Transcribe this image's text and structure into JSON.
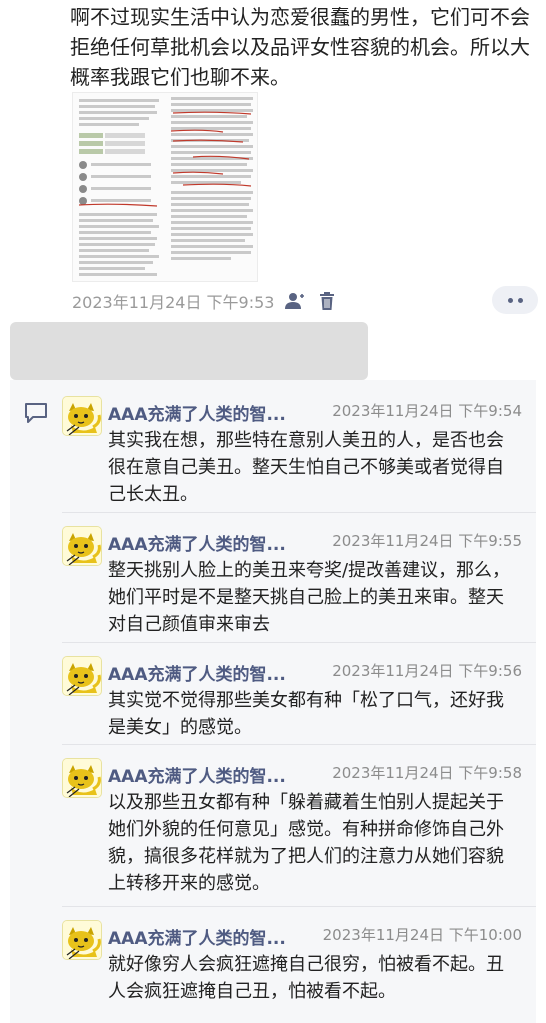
{
  "post": {
    "text": "啊不过现实生活中认为恋爱很蠢的男性，它们可不会拒绝任何草批机会以及品评女性容貌的机会。所以大概率我跟它们也聊不来。",
    "timestamp": "2023年11月24日 下午9:53",
    "icons": [
      "user-icon",
      "trash-icon",
      "more-icon"
    ]
  },
  "comments": [
    {
      "author": "AAA充满了人类的智...",
      "time": "2023年11月24日 下午9:54",
      "text": "其实我在想，那些特在意别人美丑的人，是否也会很在意自己美丑。整天生怕自己不够美或者觉得自己长太丑。"
    },
    {
      "author": "AAA充满了人类的智...",
      "time": "2023年11月24日 下午9:55",
      "text": "整天挑别人脸上的美丑来夸奖/提改善建议，那么，她们平时是不是整天挑自己脸上的美丑来审。整天对自己颜值审来审去"
    },
    {
      "author": "AAA充满了人类的智...",
      "time": "2023年11月24日 下午9:56",
      "text": "其实觉不觉得那些美女都有种「松了口气，还好我是美女」的感觉。"
    },
    {
      "author": "AAA充满了人类的智...",
      "time": "2023年11月24日 下午9:58",
      "text": "以及那些丑女都有种「躲着藏着生怕别人提起关于她们外貌的任何意见」感觉。有种拼命修饰自己外貌，搞很多花样就为了把人们的注意力从她们容貌上转移开来的感觉。"
    },
    {
      "author": "AAA充满了人类的智...",
      "time": "2023年11月24日 下午10:00",
      "text": "就好像穷人会疯狂遮掩自己很穷，怕被看不起。丑人会疯狂遮掩自己丑，怕被看不起。"
    }
  ],
  "colors": {
    "name": "#4f5b82",
    "meta": "#9a9a9a",
    "panel": "#f6f7f9"
  }
}
